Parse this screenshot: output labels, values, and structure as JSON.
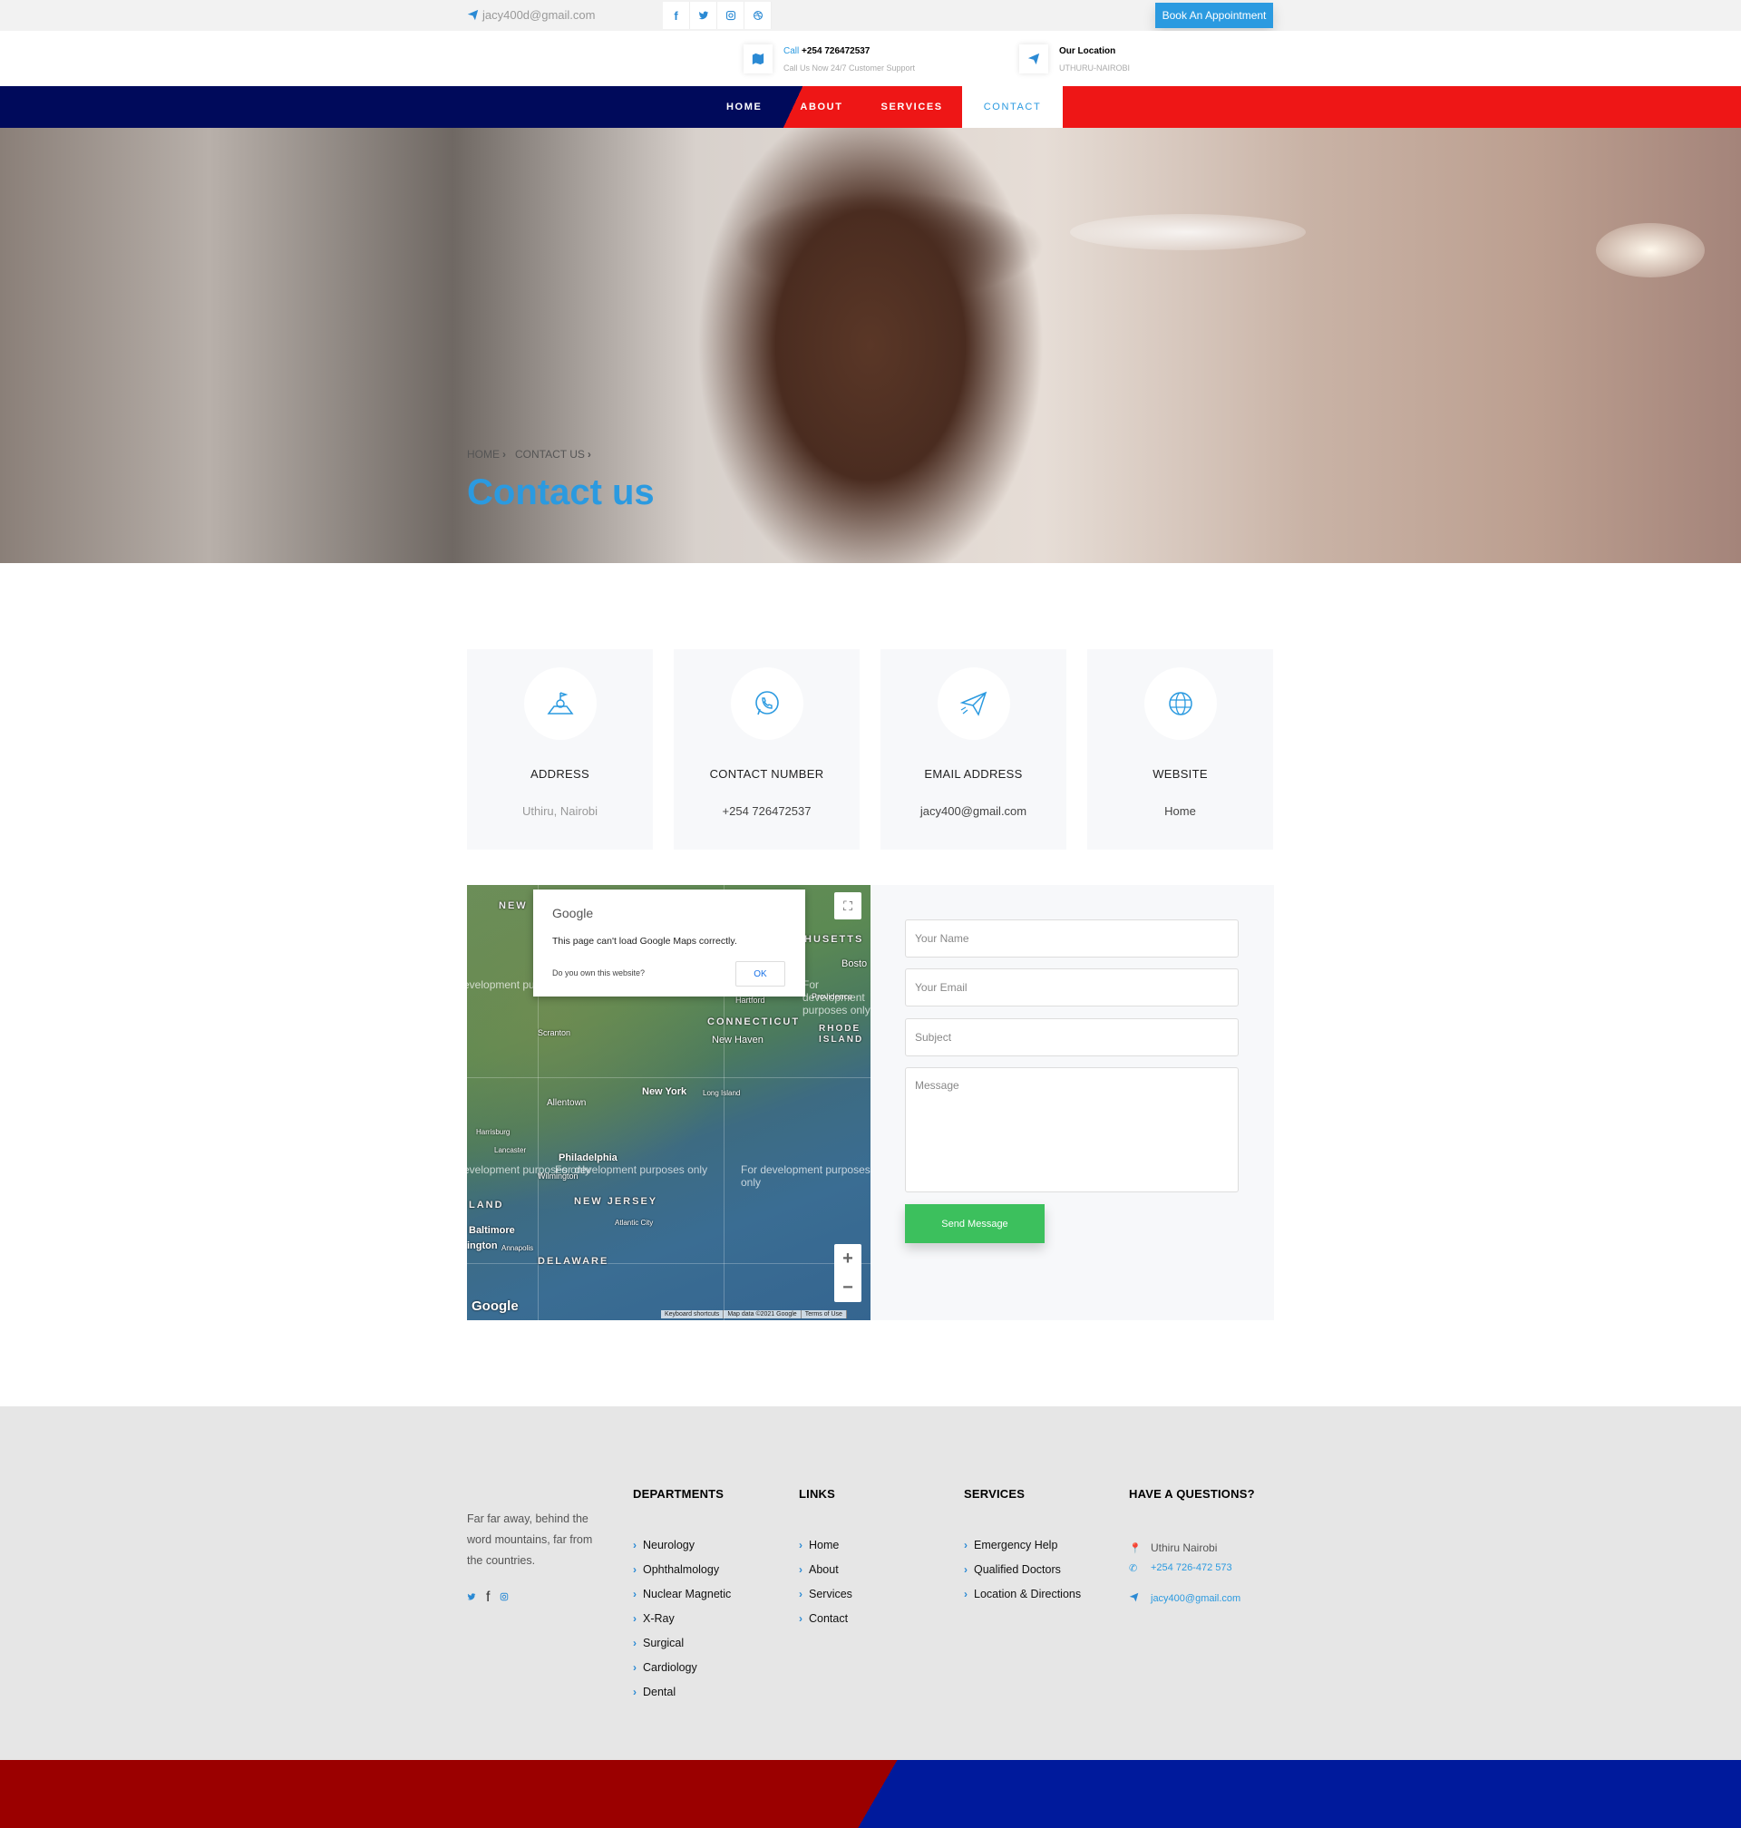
{
  "topbar": {
    "email": "jacy400d@gmail.com",
    "social": [
      "f",
      "t",
      "ig",
      "dr"
    ],
    "social_icons": [
      "facebook-icon",
      "twitter-icon",
      "instagram-icon",
      "dribbble-icon"
    ],
    "book_label": "Book An Appointment"
  },
  "infobar": {
    "call_prefix": "Call",
    "call_number": "+254 726472537",
    "call_sub": "Call Us Now 24/7 Customer Support",
    "location_title": "Our Location",
    "location_sub": "UTHURU-NAIROBI"
  },
  "nav": {
    "items": [
      "HOME",
      "ABOUT",
      "SERVICES",
      "CONTACT"
    ],
    "active": "CONTACT"
  },
  "hero": {
    "breadcrumb": [
      "HOME",
      "CONTACT US"
    ],
    "title": "Contact us"
  },
  "cards": [
    {
      "title": "ADDRESS",
      "value": "Uthiru, Nairobi",
      "icon": "map-location-icon"
    },
    {
      "title": "CONTACT NUMBER",
      "value": "+254 726472537",
      "icon": "whatsapp-icon"
    },
    {
      "title": "EMAIL ADDRESS",
      "value": "jacy400@gmail.com",
      "icon": "paper-plane-icon"
    },
    {
      "title": "WEBSITE",
      "value": "Home",
      "icon": "globe-icon"
    }
  ],
  "map": {
    "dialog_brand": "Google",
    "dialog_message": "This page can't load Google Maps correctly.",
    "dialog_question": "Do you own this website?",
    "dialog_ok": "OK",
    "dev_text": "For development purposes only",
    "labels": [
      "NEW",
      "HUSETTS",
      "Bosto",
      "Hartford",
      "Providence",
      "CONNECTICUT",
      "RHODE ISLAND",
      "New Haven",
      "Scranton",
      "New York",
      "Long Island",
      "Allentown",
      "Philadelphia",
      "Wilmington",
      "NEW JERSEY",
      "Lancaster",
      "Harrisburg",
      "Baltimore",
      "ington",
      "Annapolis",
      "DELAWARE",
      "LAND",
      "Atlantic City"
    ],
    "google_logo": "Google",
    "attribution": [
      "Keyboard shortcuts",
      "Map data ©2021 Google",
      "Terms of Use"
    ]
  },
  "form": {
    "name_placeholder": "Your Name",
    "email_placeholder": "Your Email",
    "subject_placeholder": "Subject",
    "message_placeholder": "Message",
    "send_label": "Send Message"
  },
  "footer": {
    "about": "Far far away, behind the word mountains, far from the countries.",
    "social": [
      "t",
      "f",
      "ig"
    ],
    "departments_title": "DEPARTMENTS",
    "departments": [
      "Neurology",
      "Ophthalmology",
      "Nuclear Magnetic",
      "X-Ray",
      "Surgical",
      "Cardiology",
      "Dental"
    ],
    "links_title": "LINKS",
    "links": [
      "Home",
      "About",
      "Services",
      "Contact"
    ],
    "services_title": "SERVICES",
    "services": [
      "Emergency Help",
      "Qualified Doctors",
      "Location & Directions"
    ],
    "questions_title": "HAVE A QUESTIONS?",
    "address": "Uthiru Nairobi",
    "phone": "+254 726-472 573",
    "email": "jacy400@gmail.com"
  },
  "colors": {
    "accent": "#2b9ae0",
    "nav_blue": "#000a5b",
    "nav_red": "#ee1616",
    "send_green": "#3cc05d",
    "bottom_red": "#9b0000",
    "bottom_blue": "#001a9c"
  }
}
